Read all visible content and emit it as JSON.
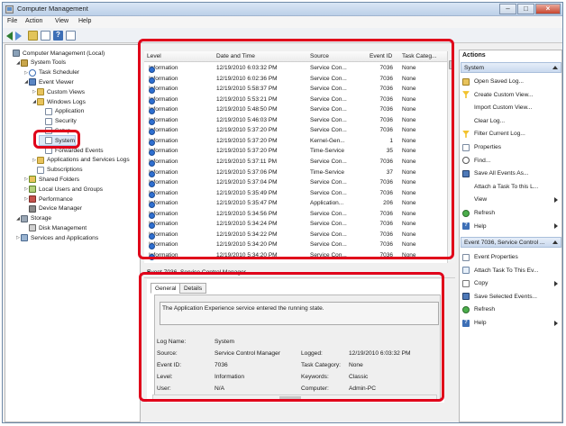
{
  "window": {
    "title": "Computer Management"
  },
  "menu": [
    "File",
    "Action",
    "View",
    "Help"
  ],
  "tree": [
    {
      "label": "Computer Management (Local)",
      "icon": "computer-icon",
      "indent": 0,
      "twisty": ""
    },
    {
      "label": "System Tools",
      "icon": "tools-icon",
      "indent": 1,
      "twisty": "◢"
    },
    {
      "label": "Task Scheduler",
      "icon": "clock-icon",
      "indent": 2,
      "twisty": "▷"
    },
    {
      "label": "Event Viewer",
      "icon": "event-viewer-icon",
      "indent": 2,
      "twisty": "◢"
    },
    {
      "label": "Custom Views",
      "icon": "folder-icon",
      "indent": 3,
      "twisty": "▷"
    },
    {
      "label": "Windows Logs",
      "icon": "folder-icon",
      "indent": 3,
      "twisty": "◢"
    },
    {
      "label": "Application",
      "icon": "log-icon",
      "indent": 4,
      "twisty": ""
    },
    {
      "label": "Security",
      "icon": "log-icon",
      "indent": 4,
      "twisty": ""
    },
    {
      "label": "Setup",
      "icon": "log-icon",
      "indent": 4,
      "twisty": ""
    },
    {
      "label": "System",
      "icon": "log-icon",
      "indent": 4,
      "twisty": ""
    },
    {
      "label": "Forwarded Events",
      "icon": "log-icon",
      "indent": 4,
      "twisty": ""
    },
    {
      "label": "Applications and Services Logs",
      "icon": "folder-icon",
      "indent": 3,
      "twisty": "▷"
    },
    {
      "label": "Subscriptions",
      "icon": "log-icon",
      "indent": 3,
      "twisty": ""
    },
    {
      "label": "Shared Folders",
      "icon": "shared-folder-icon",
      "indent": 2,
      "twisty": "▷"
    },
    {
      "label": "Local Users and Groups",
      "icon": "users-icon",
      "indent": 2,
      "twisty": "▷"
    },
    {
      "label": "Performance",
      "icon": "performance-icon",
      "indent": 2,
      "twisty": "▷"
    },
    {
      "label": "Device Manager",
      "icon": "device-icon",
      "indent": 2,
      "twisty": ""
    },
    {
      "label": "Storage",
      "icon": "storage-icon",
      "indent": 1,
      "twisty": "◢"
    },
    {
      "label": "Disk Management",
      "icon": "disk-icon",
      "indent": 2,
      "twisty": ""
    },
    {
      "label": "Services and Applications",
      "icon": "services-icon",
      "indent": 1,
      "twisty": "▷"
    }
  ],
  "events": {
    "columns": [
      "Level",
      "Date and Time",
      "Source",
      "Event ID",
      "Task Categ..."
    ],
    "rows": [
      {
        "level": "Information",
        "date": "12/19/2010 6:03:32 PM",
        "source": "Service Con...",
        "id": "7036",
        "cat": "None"
      },
      {
        "level": "Information",
        "date": "12/19/2010 6:02:36 PM",
        "source": "Service Con...",
        "id": "7036",
        "cat": "None"
      },
      {
        "level": "Information",
        "date": "12/19/2010 5:58:37 PM",
        "source": "Service Con...",
        "id": "7036",
        "cat": "None"
      },
      {
        "level": "Information",
        "date": "12/19/2010 5:53:21 PM",
        "source": "Service Con...",
        "id": "7036",
        "cat": "None"
      },
      {
        "level": "Information",
        "date": "12/19/2010 5:48:50 PM",
        "source": "Service Con...",
        "id": "7036",
        "cat": "None"
      },
      {
        "level": "Information",
        "date": "12/19/2010 5:46:03 PM",
        "source": "Service Con...",
        "id": "7036",
        "cat": "None"
      },
      {
        "level": "Information",
        "date": "12/19/2010 5:37:20 PM",
        "source": "Service Con...",
        "id": "7036",
        "cat": "None"
      },
      {
        "level": "Information",
        "date": "12/19/2010 5:37:20 PM",
        "source": "Kernel-Gen...",
        "id": "1",
        "cat": "None"
      },
      {
        "level": "Information",
        "date": "12/19/2010 5:37:20 PM",
        "source": "Time-Service",
        "id": "35",
        "cat": "None"
      },
      {
        "level": "Information",
        "date": "12/19/2010 5:37:11 PM",
        "source": "Service Con...",
        "id": "7036",
        "cat": "None"
      },
      {
        "level": "Information",
        "date": "12/19/2010 5:37:06 PM",
        "source": "Time-Service",
        "id": "37",
        "cat": "None"
      },
      {
        "level": "Information",
        "date": "12/19/2010 5:37:04 PM",
        "source": "Service Con...",
        "id": "7036",
        "cat": "None"
      },
      {
        "level": "Information",
        "date": "12/19/2010 5:35:49 PM",
        "source": "Service Con...",
        "id": "7036",
        "cat": "None"
      },
      {
        "level": "Information",
        "date": "12/19/2010 5:35:47 PM",
        "source": "Application...",
        "id": "206",
        "cat": "None"
      },
      {
        "level": "Information",
        "date": "12/19/2010 5:34:56 PM",
        "source": "Service Con...",
        "id": "7036",
        "cat": "None"
      },
      {
        "level": "Information",
        "date": "12/19/2010 5:34:24 PM",
        "source": "Service Con...",
        "id": "7036",
        "cat": "None"
      },
      {
        "level": "Information",
        "date": "12/19/2010 5:34:22 PM",
        "source": "Service Con...",
        "id": "7036",
        "cat": "None"
      },
      {
        "level": "Information",
        "date": "12/19/2010 5:34:20 PM",
        "source": "Service Con...",
        "id": "7036",
        "cat": "None"
      },
      {
        "level": "Information",
        "date": "12/19/2010 5:34:20 PM",
        "source": "Service Con...",
        "id": "7036",
        "cat": "None"
      }
    ]
  },
  "detail": {
    "header": "Event 7036, Service Control Manager",
    "close": "×",
    "tabs": [
      "General",
      "Details"
    ],
    "message": "The Application Experience service entered the running state.",
    "fields": {
      "log_name_label": "Log Name:",
      "log_name": "System",
      "source_label": "Source:",
      "source": "Service Control Manager",
      "logged_label": "Logged:",
      "logged": "12/19/2010 6:03:32 PM",
      "event_id_label": "Event ID:",
      "event_id": "7036",
      "task_category_label": "Task Category:",
      "task_category": "None",
      "level_label": "Level:",
      "level": "Information",
      "keywords_label": "Keywords:",
      "keywords": "Classic",
      "user_label": "User:",
      "user": "N/A",
      "computer_label": "Computer:",
      "computer": "Admin-PC"
    }
  },
  "actions": {
    "title": "Actions",
    "section1": "System",
    "section1_items": [
      {
        "label": "Open Saved Log...",
        "icon": "open-icon",
        "sub": false
      },
      {
        "label": "Create Custom View...",
        "icon": "filter-icon",
        "sub": false
      },
      {
        "label": "Import Custom View...",
        "icon": "blank",
        "sub": false
      },
      {
        "label": "Clear Log...",
        "icon": "blank",
        "sub": false
      },
      {
        "label": "Filter Current Log...",
        "icon": "filter-icon",
        "sub": false
      },
      {
        "label": "Properties",
        "icon": "properties-icon",
        "sub": false
      },
      {
        "label": "Find...",
        "icon": "find-icon",
        "sub": false
      },
      {
        "label": "Save All Events As...",
        "icon": "save-icon",
        "sub": false
      },
      {
        "label": "Attach a Task To this L...",
        "icon": "blank",
        "sub": false
      },
      {
        "label": "View",
        "icon": "blank",
        "sub": true
      },
      {
        "label": "Refresh",
        "icon": "refresh-icon",
        "sub": false
      },
      {
        "label": "Help",
        "icon": "help-icon",
        "sub": true
      }
    ],
    "section2": "Event 7036, Service Control ...",
    "section2_items": [
      {
        "label": "Event Properties",
        "icon": "properties-icon",
        "sub": false
      },
      {
        "label": "Attach Task To This Ev...",
        "icon": "task-icon",
        "sub": false
      },
      {
        "label": "Copy",
        "icon": "copy-icon",
        "sub": true
      },
      {
        "label": "Save Selected Events...",
        "icon": "save-icon",
        "sub": false
      },
      {
        "label": "Refresh",
        "icon": "refresh-icon",
        "sub": false
      },
      {
        "label": "Help",
        "icon": "help-icon",
        "sub": true
      }
    ]
  },
  "colors": {
    "annotation": "#e0001a",
    "info_icon": "#2f6fd0",
    "section_bar": "#c9d9ee"
  }
}
